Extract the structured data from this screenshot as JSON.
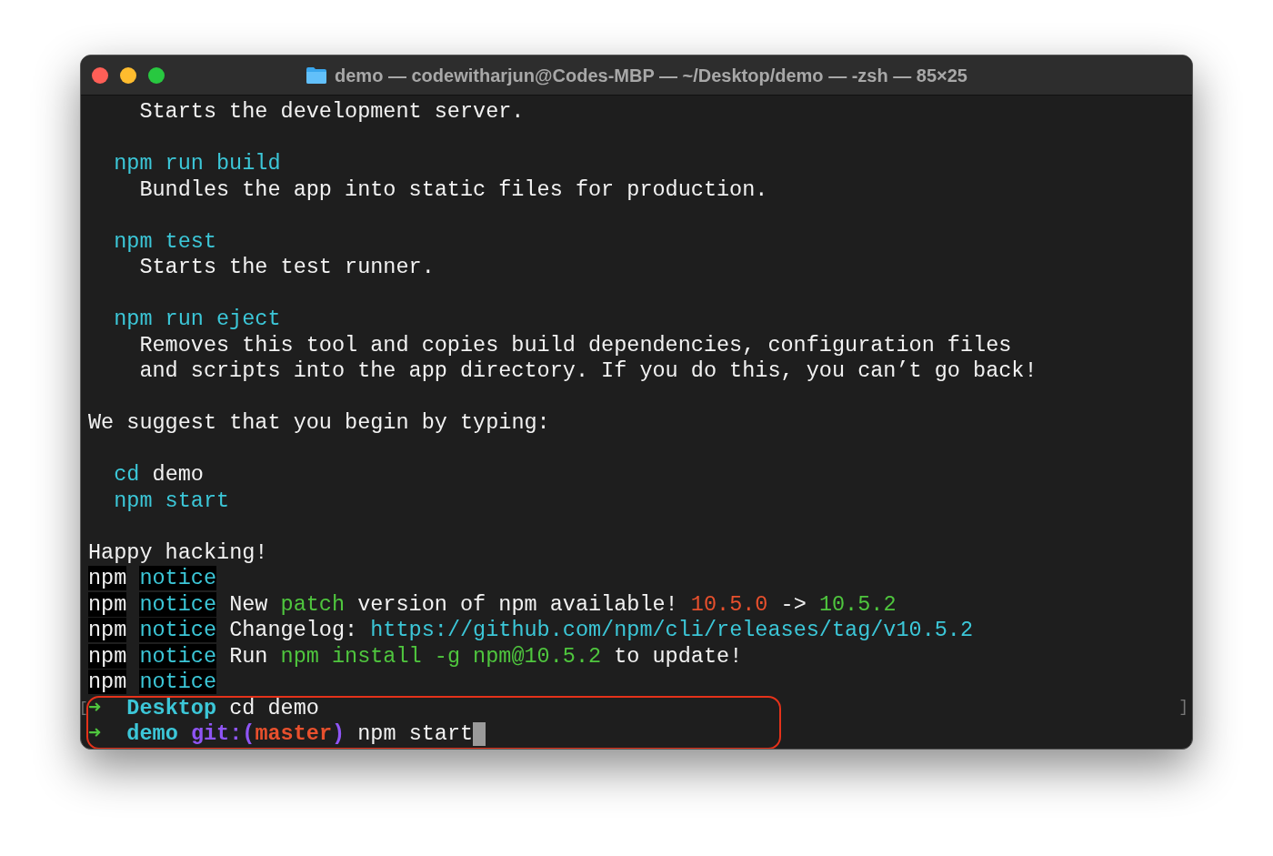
{
  "window": {
    "title": "demo — codewitharjun@Codes-MBP — ~/Desktop/demo — -zsh — 85×25"
  },
  "lines": [
    {
      "kind": "description",
      "segments": [
        {
          "kind": "plain",
          "text": "Starts the development server."
        }
      ]
    },
    {
      "kind": "blank"
    },
    {
      "kind": "command",
      "segments": [
        {
          "kind": "cyan",
          "text": "npm run build"
        }
      ]
    },
    {
      "kind": "description",
      "segments": [
        {
          "kind": "plain",
          "text": "Bundles the app into static files for production."
        }
      ]
    },
    {
      "kind": "blank"
    },
    {
      "kind": "command",
      "segments": [
        {
          "kind": "cyan",
          "text": "npm test"
        }
      ]
    },
    {
      "kind": "description",
      "segments": [
        {
          "kind": "plain",
          "text": "Starts the test runner."
        }
      ]
    },
    {
      "kind": "blank"
    },
    {
      "kind": "command",
      "segments": [
        {
          "kind": "cyan",
          "text": "npm run eject"
        }
      ]
    },
    {
      "kind": "description",
      "segments": [
        {
          "kind": "plain",
          "text": "Removes this tool and copies build dependencies, configuration files"
        }
      ]
    },
    {
      "kind": "description",
      "segments": [
        {
          "kind": "plain",
          "text": "and scripts into the app directory. If you do this, you can’t go back!"
        }
      ]
    },
    {
      "kind": "blank"
    },
    {
      "kind": "plain",
      "segments": [
        {
          "kind": "plain",
          "text": "We suggest that you begin by typing:"
        }
      ]
    },
    {
      "kind": "blank"
    },
    {
      "kind": "command",
      "segments": [
        {
          "kind": "cyan",
          "text": "cd"
        },
        {
          "kind": "plain",
          "text": " demo"
        }
      ]
    },
    {
      "kind": "command",
      "segments": [
        {
          "kind": "cyan",
          "text": "npm start"
        }
      ]
    },
    {
      "kind": "blank"
    },
    {
      "kind": "plain",
      "segments": [
        {
          "kind": "plain",
          "text": "Happy hacking!"
        }
      ]
    },
    {
      "kind": "plain",
      "segments": [
        {
          "kind": "npm",
          "text": "npm"
        },
        {
          "kind": "notice",
          "text": "notice"
        }
      ]
    },
    {
      "kind": "plain",
      "segments": [
        {
          "kind": "npm",
          "text": "npm"
        },
        {
          "kind": "notice",
          "text": "notice"
        },
        {
          "kind": "plain",
          "text": " New "
        },
        {
          "kind": "green",
          "text": "patch"
        },
        {
          "kind": "plain",
          "text": " version of npm available! "
        },
        {
          "kind": "red",
          "text": "10.5.0"
        },
        {
          "kind": "plain",
          "text": " -> "
        },
        {
          "kind": "green",
          "text": "10.5.2"
        }
      ]
    },
    {
      "kind": "plain",
      "segments": [
        {
          "kind": "npm",
          "text": "npm"
        },
        {
          "kind": "notice",
          "text": "notice"
        },
        {
          "kind": "plain",
          "text": " Changelog: "
        },
        {
          "kind": "link",
          "text": "https://github.com/npm/cli/releases/tag/v10.5.2"
        }
      ]
    },
    {
      "kind": "plain",
      "segments": [
        {
          "kind": "npm",
          "text": "npm"
        },
        {
          "kind": "notice",
          "text": "notice"
        },
        {
          "kind": "plain",
          "text": " Run "
        },
        {
          "kind": "green",
          "text": "npm install -g npm@10.5.2"
        },
        {
          "kind": "plain",
          "text": " to update!"
        }
      ]
    },
    {
      "kind": "plain",
      "segments": [
        {
          "kind": "npm",
          "text": "npm"
        },
        {
          "kind": "notice",
          "text": "notice"
        }
      ]
    }
  ],
  "prompt": {
    "bracket_left": "[",
    "bracket_right": "]",
    "lines": [
      {
        "cursor": false,
        "segments": [
          {
            "kind": "arrow",
            "text": "➜"
          },
          {
            "kind": "dir",
            "text": "Desktop"
          },
          {
            "kind": "plain",
            "text": " cd demo"
          }
        ]
      },
      {
        "cursor": true,
        "segments": [
          {
            "kind": "arrow",
            "text": "➜"
          },
          {
            "kind": "dir",
            "text": "demo"
          },
          {
            "kind": "git",
            "text": " git:("
          },
          {
            "kind": "branch",
            "text": "master"
          },
          {
            "kind": "git",
            "text": ")"
          },
          {
            "kind": "plain",
            "text": " npm start"
          }
        ]
      }
    ]
  }
}
